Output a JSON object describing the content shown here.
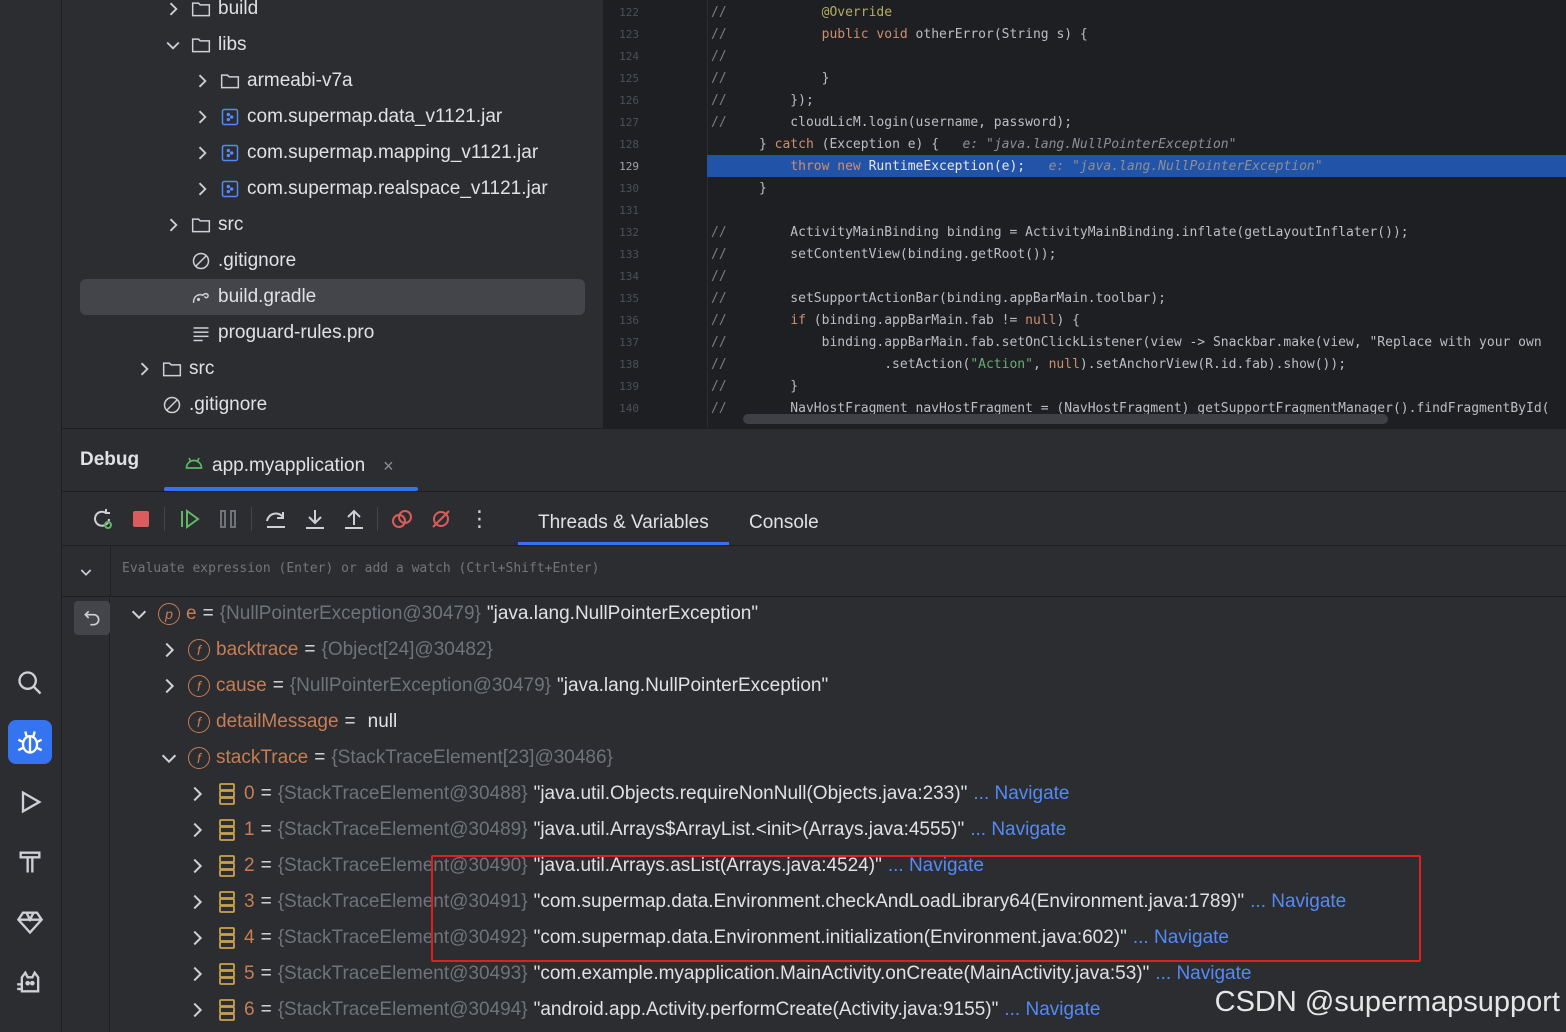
{
  "project_tree": {
    "items": [
      {
        "label": "build",
        "kind": "folder",
        "chevron": "collapsed"
      },
      {
        "label": "libs",
        "kind": "folder",
        "chevron": "expanded"
      },
      {
        "label": "armeabi-v7a",
        "kind": "folder",
        "chevron": "collapsed"
      },
      {
        "label": "com.supermap.data_v1121.jar",
        "kind": "jar",
        "chevron": "collapsed"
      },
      {
        "label": "com.supermap.mapping_v1121.jar",
        "kind": "jar",
        "chevron": "collapsed"
      },
      {
        "label": "com.supermap.realspace_v1121.jar",
        "kind": "jar",
        "chevron": "collapsed"
      },
      {
        "label": "src",
        "kind": "folder",
        "chevron": "collapsed"
      },
      {
        "label": ".gitignore",
        "kind": "ignore",
        "chevron": "none"
      },
      {
        "label": "build.gradle",
        "kind": "gradle",
        "chevron": "none",
        "selected": true
      },
      {
        "label": "proguard-rules.pro",
        "kind": "text",
        "chevron": "none"
      },
      {
        "label": "src",
        "kind": "folder",
        "chevron": "collapsed"
      },
      {
        "label": ".gitignore",
        "kind": "ignore",
        "chevron": "none"
      }
    ]
  },
  "editor": {
    "lines": [
      {
        "n": "122",
        "c": "//",
        "t": "        @Override"
      },
      {
        "n": "123",
        "c": "//",
        "t": "        public void otherError(String s) {"
      },
      {
        "n": "124",
        "c": "//",
        "t": ""
      },
      {
        "n": "125",
        "c": "//",
        "t": "        }"
      },
      {
        "n": "126",
        "c": "//",
        "t": "    });"
      },
      {
        "n": "127",
        "c": "//",
        "t": "    cloudLicM.login(username, password);"
      },
      {
        "n": "128",
        "c": "",
        "t": "} catch (Exception e) {",
        "hint": "e: \"java.lang.NullPointerException\""
      },
      {
        "n": "129",
        "c": "",
        "t": "    throw new RuntimeException(e);",
        "hint": "e: \"java.lang.NullPointerException\"",
        "highlight": true
      },
      {
        "n": "130",
        "c": "",
        "t": "}"
      },
      {
        "n": "131",
        "c": "",
        "t": ""
      },
      {
        "n": "132",
        "c": "//",
        "t": "    ActivityMainBinding binding = ActivityMainBinding.inflate(getLayoutInflater());"
      },
      {
        "n": "133",
        "c": "//",
        "t": "    setContentView(binding.getRoot());"
      },
      {
        "n": "134",
        "c": "//",
        "t": ""
      },
      {
        "n": "135",
        "c": "//",
        "t": "    setSupportActionBar(binding.appBarMain.toolbar);"
      },
      {
        "n": "136",
        "c": "//",
        "t": "    if (binding.appBarMain.fab != null) {"
      },
      {
        "n": "137",
        "c": "//",
        "t": "        binding.appBarMain.fab.setOnClickListener(view -> Snackbar.make(view, \"Replace with your own"
      },
      {
        "n": "138",
        "c": "//",
        "t": "                .setAction(\"Action\", null).setAnchorView(R.id.fab).show());"
      },
      {
        "n": "139",
        "c": "//",
        "t": "    }"
      },
      {
        "n": "140",
        "c": "//",
        "t": "    NavHostFragment navHostFragment = (NavHostFragment) getSupportFragmentManager().findFragmentById("
      }
    ]
  },
  "debug": {
    "title": "Debug",
    "session_tab": "app.myapplication",
    "close_glyph": "×",
    "subtabs": [
      "Threads & Variables",
      "Console"
    ],
    "eval_placeholder": "Evaluate expression (Enter) or add a watch (Ctrl+Shift+Enter)",
    "more_glyph": "⋮",
    "variables": [
      {
        "chev": "expanded",
        "icon": "p",
        "name": "e",
        "type": "{NullPointerException@30479}",
        "value": "\"java.lang.NullPointerException\"",
        "nav": ""
      },
      {
        "chev": "collapsed",
        "icon": "f",
        "name": "backtrace",
        "type": "{Object[24]@30482}",
        "value": "",
        "nav": ""
      },
      {
        "chev": "collapsed",
        "icon": "f",
        "name": "cause",
        "type": "{NullPointerException@30479}",
        "value": "\"java.lang.NullPointerException\"",
        "nav": ""
      },
      {
        "chev": "none",
        "icon": "f",
        "name": "detailMessage",
        "type": "",
        "value": "null",
        "nav": ""
      },
      {
        "chev": "expanded",
        "icon": "f",
        "name": "stackTrace",
        "type": "{StackTraceElement[23]@30486}",
        "value": "",
        "nav": ""
      },
      {
        "chev": "collapsed",
        "icon": "arr",
        "name": "0",
        "type": "{StackTraceElement@30488}",
        "value": "\"java.util.Objects.requireNonNull(Objects.java:233)\"",
        "nav": "... Navigate"
      },
      {
        "chev": "collapsed",
        "icon": "arr",
        "name": "1",
        "type": "{StackTraceElement@30489}",
        "value": "\"java.util.Arrays$ArrayList.<init>(Arrays.java:4555)\"",
        "nav": "... Navigate"
      },
      {
        "chev": "collapsed",
        "icon": "arr",
        "name": "2",
        "type": "{StackTraceElement@30490}",
        "value": "\"java.util.Arrays.asList(Arrays.java:4524)\"",
        "nav": "... Navigate"
      },
      {
        "chev": "collapsed",
        "icon": "arr",
        "name": "3",
        "type": "{StackTraceElement@30491}",
        "value": "\"com.supermap.data.Environment.checkAndLoadLibrary64(Environment.java:1789)\"",
        "nav": "... Navigate"
      },
      {
        "chev": "collapsed",
        "icon": "arr",
        "name": "4",
        "type": "{StackTraceElement@30492}",
        "value": "\"com.supermap.data.Environment.initialization(Environment.java:602)\"",
        "nav": "... Navigate"
      },
      {
        "chev": "collapsed",
        "icon": "arr",
        "name": "5",
        "type": "{StackTraceElement@30493}",
        "value": "\"com.example.myapplication.MainActivity.onCreate(MainActivity.java:53)\"",
        "nav": "... Navigate"
      },
      {
        "chev": "collapsed",
        "icon": "arr",
        "name": "6",
        "type": "{StackTraceElement@30494}",
        "value": "\"android.app.Activity.performCreate(Activity.java:9155)\"",
        "nav": "... Navigate"
      }
    ]
  },
  "watermark": "CSDN @supermapsupport",
  "colors": {
    "accent": "#3574f0",
    "highlight_box": "#e0201f",
    "var_name": "#c77d55",
    "navigate": "#548af7"
  }
}
